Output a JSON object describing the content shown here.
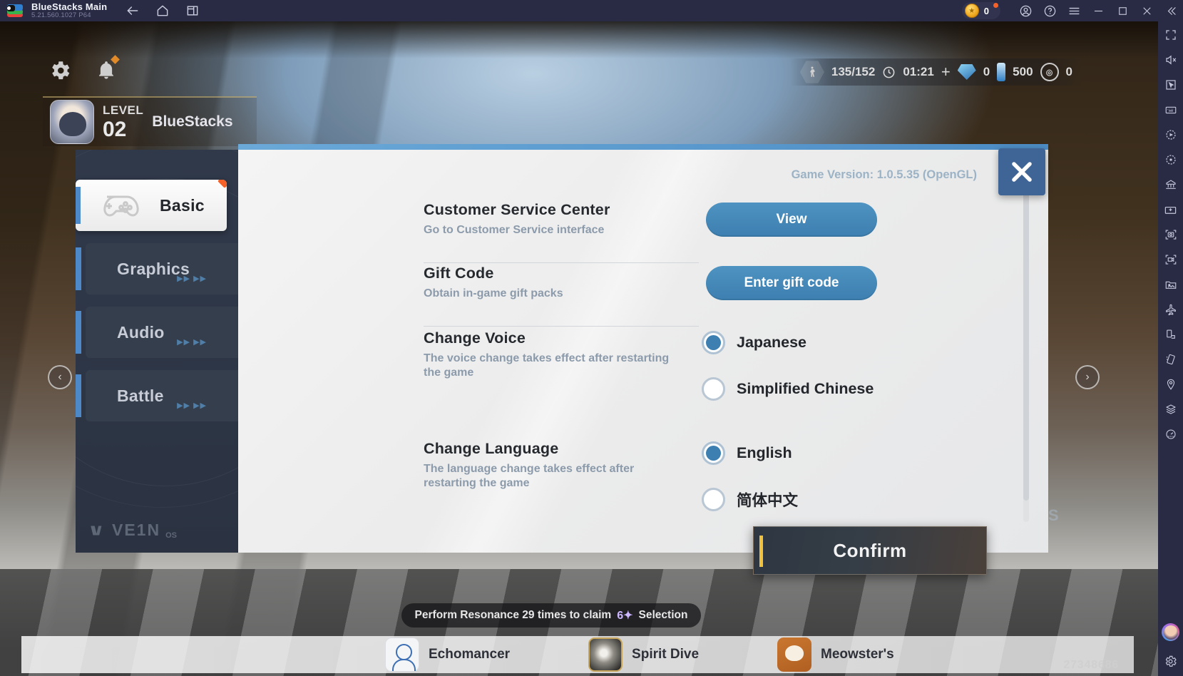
{
  "titlebar": {
    "app_name": "BlueStacks Main",
    "version": "5.21.560.1027  P64",
    "coin_count": "0",
    "icons": [
      "back-arrow-icon",
      "home-icon",
      "multi-instance-icon"
    ],
    "system_icons": [
      "account-icon",
      "help-icon",
      "menu-icon",
      "minimize-icon",
      "maximize-icon",
      "close-icon",
      "collapse-icon"
    ]
  },
  "rail": {
    "icons": [
      "fullscreen-icon",
      "mute-icon",
      "cursor-icon",
      "keyboard-controls-icon",
      "macro-record-icon",
      "script-icon",
      "multi-instance-manager-icon",
      "install-apk-icon",
      "screenshot-icon",
      "record-video-icon",
      "media-manager-icon",
      "airplane-mode-icon",
      "rotate-screen-icon",
      "shake-icon",
      "location-icon",
      "layers-icon",
      "performance-icon"
    ],
    "bottom_icons": [
      "user-avatar",
      "settings-gear-icon"
    ]
  },
  "game_hud": {
    "gear_icon": "settings-gear-icon",
    "bell_icon": "notification-bell-icon",
    "level_word": "LEVEL",
    "level_number": "02",
    "player_name": "BlueStacks",
    "stamina": "135/152",
    "timer": "01:21",
    "plus": "+",
    "gem_count": "0",
    "flask_count": "500",
    "coin_count": "0",
    "nav_left": "‹",
    "nav_right": "›"
  },
  "bottom": {
    "banner_pre": "Perform Resonance 29 times to claim",
    "banner_star": "6✦",
    "banner_post": "Selection",
    "items": [
      {
        "label": "Echomancer",
        "icon": "echomancer-icon"
      },
      {
        "label": "Spirit Dive",
        "icon": "spirit-dive-icon"
      },
      {
        "label": "Meowster's",
        "icon": "meowster-icon"
      }
    ],
    "watermark": "27348686"
  },
  "settings": {
    "game_version": "Game Version: 1.0.5.35 (OpenGL)",
    "close_icon": "close-icon",
    "brand": "VE1N",
    "brand_sup": "OS",
    "tabs": [
      {
        "label": "Basic",
        "icon": "gamepad-icon",
        "active": true,
        "badge": true,
        "arrows": ""
      },
      {
        "label": "Graphics",
        "icon": "graphics-icon",
        "active": false,
        "badge": false,
        "arrows": "▶▶ ▶▶"
      },
      {
        "label": "Audio",
        "icon": "audio-icon",
        "active": false,
        "badge": false,
        "arrows": "▶▶ ▶▶"
      },
      {
        "label": "Battle",
        "icon": "battle-icon",
        "active": false,
        "badge": false,
        "arrows": "▶▶ ▶▶"
      }
    ],
    "rows": [
      {
        "title": "Customer Service Center",
        "sub": "Go to Customer Service interface"
      },
      {
        "title": "Gift Code",
        "sub": "Obtain in-game gift packs"
      },
      {
        "title": "Change Voice",
        "sub": "The voice change takes effect after restarting the game"
      },
      {
        "title": "Change Language",
        "sub": "The language change takes effect after restarting the game"
      }
    ],
    "buttons": {
      "view": "View",
      "gift_code": "Enter gift code"
    },
    "voice_options": [
      {
        "label": "Japanese",
        "selected": true
      },
      {
        "label": "Simplified Chinese",
        "selected": false
      }
    ],
    "language_options": [
      {
        "label": "English",
        "selected": true
      },
      {
        "label": "简体中文",
        "selected": false
      }
    ],
    "confirm_label": "Confirm",
    "side_glow": "DS"
  },
  "colors": {
    "accent_blue": "#3d7fb0",
    "titlebar": "#292b45",
    "badge_orange": "#f4622a",
    "confirm_yellow": "#f0c23c"
  }
}
